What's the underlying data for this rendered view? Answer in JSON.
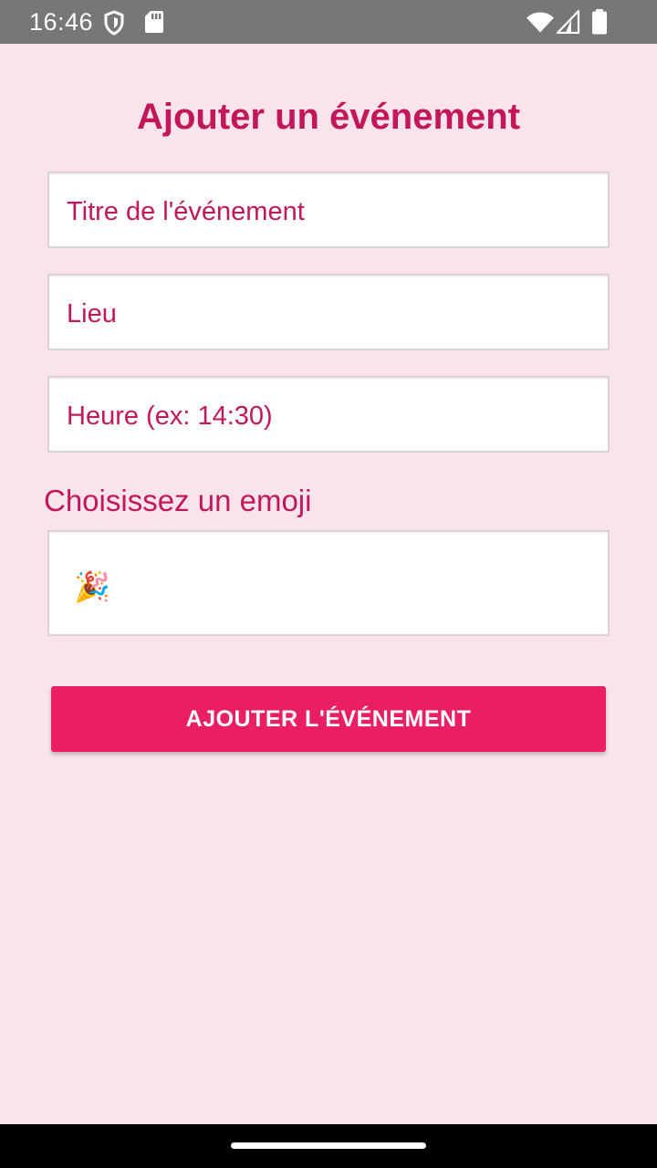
{
  "status_bar": {
    "time": "16:46",
    "icons": [
      "shield-icon",
      "sd-card-icon",
      "wifi-icon",
      "cell-signal-icon",
      "battery-icon"
    ]
  },
  "form": {
    "title": "Ajouter un événement",
    "event_title_placeholder": "Titre de l'événement",
    "place_placeholder": "Lieu",
    "time_placeholder": "Heure (ex: 14:30)",
    "emoji_label": "Choisissez un emoji",
    "emoji_value": "🎉",
    "submit_label": "AJOUTER L'ÉVÉNEMENT"
  },
  "colors": {
    "background": "#fae4ec",
    "accent": "#c2185b",
    "button": "#e91e63",
    "status_bar": "#777777"
  }
}
